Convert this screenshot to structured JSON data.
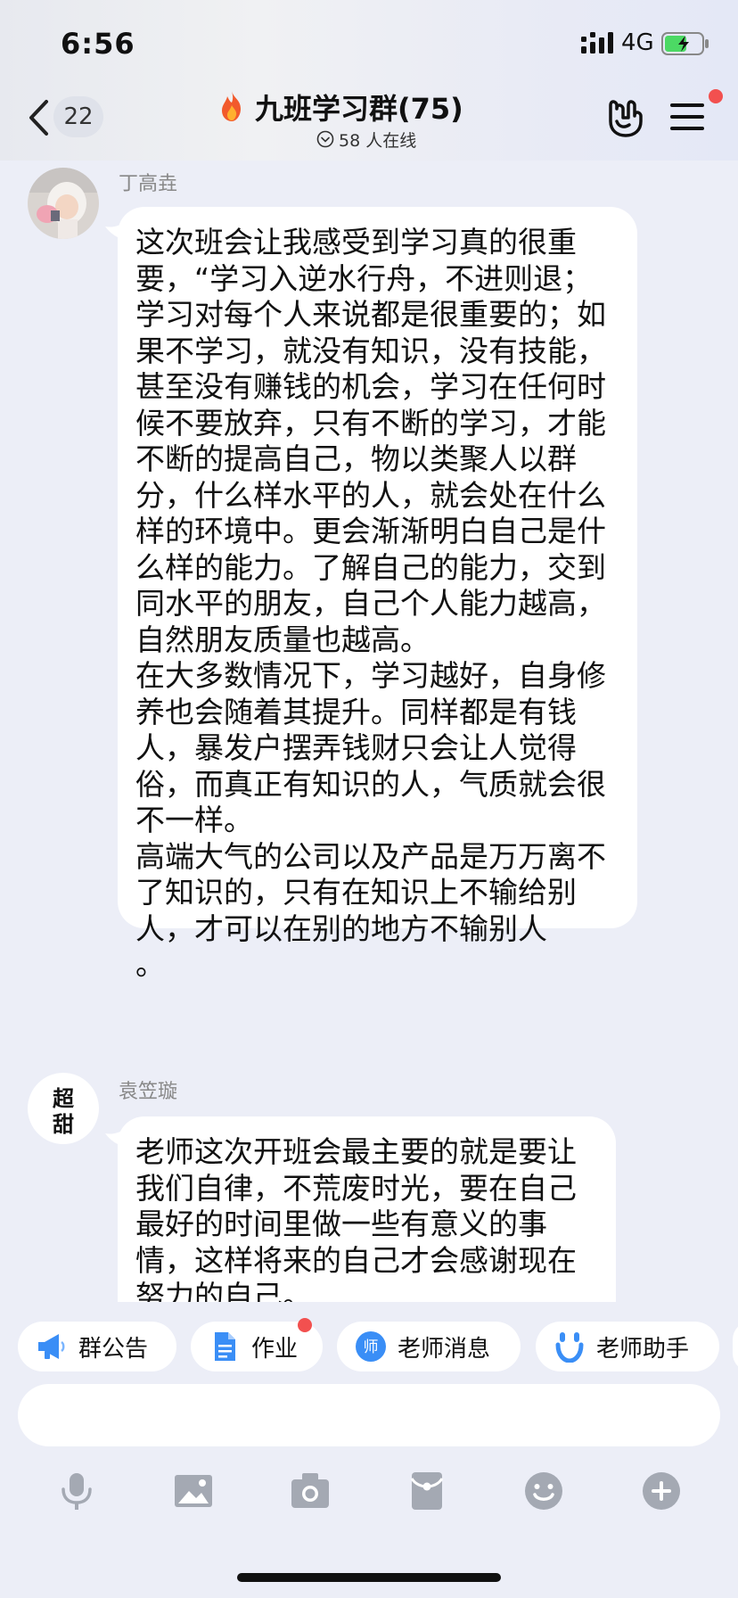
{
  "status_bar": {
    "time": "6:56",
    "network": "4G",
    "battery_level": 0.6,
    "battery_charging": true,
    "battery_color": "#4cd964"
  },
  "nav": {
    "unread_count": "22",
    "group_title": "九班学习群(75)",
    "online_text": "58 人在线",
    "icons": [
      "back-icon",
      "fire-icon",
      "online-icon",
      "hand-gesture-icon",
      "menu-icon"
    ],
    "has_menu_badge": true
  },
  "messages": [
    {
      "sender": "丁高垚",
      "avatar": "photo-avatar",
      "text": "这次班会让我感受到学习真的很重要，“学习入逆水行舟，不进则退；学习对每个人来说都是很重要的；如果不学习，就没有知识，没有技能，甚至没有赚钱的机会，学习在任何时候不要放弃，只有不断的学习，才能不断的提高自己，物以类聚人以群分，什么样水平的人，就会处在什么样的环境中。更会渐渐明白自己是什么样的能力。了解自己的能力，交到同水平的朋友，自己个人能力越高，自然朋友质量也越高。\n在大多数情况下，学习越好，自身修养也会随着其提升。同样都是有钱人，暴发户摆弄钱财只会让人觉得俗，而真正有知识的人，气质就会很不一样。\n高端大气的公司以及产品是万万离不了知识的，只有在知识上不输给别人，才可以在别的地方不输别人\n。"
    },
    {
      "sender": "袁笠璇",
      "avatar": "calligraphy-avatar",
      "avatar_text": "超甜",
      "text": "老师这次开班会最主要的就是要让我们自律，不荒废时光，要在自己最好的时间里做一些有意义的事情，这样将来的自己才会感谢现在努力的自己。\n我感触最深的就是，我觉得要对"
    }
  ],
  "quick_actions": [
    {
      "label": "群公告",
      "icon": "megaphone-icon",
      "badge": false
    },
    {
      "label": "作业",
      "icon": "document-icon",
      "badge": true
    },
    {
      "label": "老师消息",
      "icon": "teacher-icon",
      "badge": false
    },
    {
      "label": "老师助手",
      "icon": "assistant-icon",
      "badge": false
    }
  ],
  "input": {
    "value": "",
    "placeholder": ""
  },
  "toolbar_icons": [
    "microphone-icon",
    "image-icon",
    "camera-icon",
    "red-packet-icon",
    "emoji-icon",
    "plus-icon"
  ],
  "colors": {
    "background": "#eceef7",
    "accent_blue": "#3a8ef6",
    "badge_red": "#f2504f",
    "icon_gray": "#a4a9b3"
  }
}
